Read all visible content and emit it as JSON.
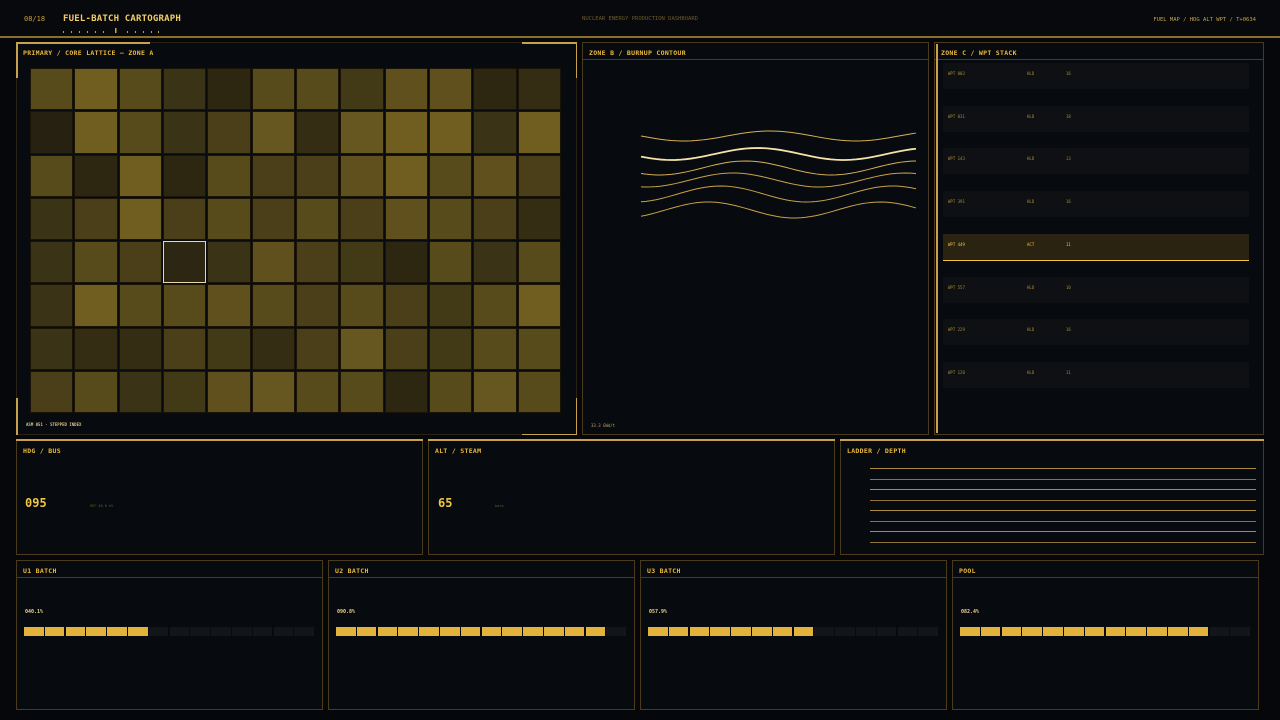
{
  "header": {
    "page_indicator": "08/18",
    "title": "FUEL-BATCH CARTOGRAPH",
    "center_label": "NUCLEAR ENERGY PRODUCTION DASHBOARD",
    "right_label": "FUEL MAP / HDG ALT WPT / T+0634"
  },
  "zone_a": {
    "title": "PRIMARY / CORE LATTICE — ZONE A",
    "footer": "ASM 051 · STEPPED INDEX",
    "rows": 8,
    "cols": 12,
    "selected_cell": 4,
    "levels": [
      [
        0.55,
        0.72,
        0.55,
        0.35,
        0.25,
        0.55,
        0.55,
        0.4,
        0.6,
        0.6,
        0.25,
        0.3
      ],
      [
        0.2,
        0.72,
        0.55,
        0.35,
        0.45,
        0.65,
        0.3,
        0.65,
        0.72,
        0.72,
        0.35,
        0.72
      ],
      [
        0.55,
        0.25,
        0.72,
        0.25,
        0.55,
        0.45,
        0.45,
        0.6,
        0.72,
        0.55,
        0.6,
        0.45
      ],
      [
        0.35,
        0.45,
        0.72,
        0.45,
        0.55,
        0.45,
        0.55,
        0.45,
        0.6,
        0.55,
        0.45,
        0.3
      ],
      [
        0.35,
        0.55,
        0.45,
        0.15,
        0.35,
        0.6,
        0.45,
        0.4,
        0.25,
        0.55,
        0.35,
        0.55
      ],
      [
        0.35,
        0.72,
        0.55,
        0.55,
        0.6,
        0.55,
        0.45,
        0.55,
        0.45,
        0.4,
        0.55,
        0.72
      ],
      [
        0.35,
        0.3,
        0.3,
        0.45,
        0.4,
        0.3,
        0.45,
        0.65,
        0.45,
        0.4,
        0.55,
        0.55
      ],
      [
        0.45,
        0.55,
        0.35,
        0.4,
        0.6,
        0.65,
        0.55,
        0.55,
        0.25,
        0.55,
        0.65,
        0.55
      ]
    ],
    "cell_labels": [
      "",
      "",
      "",
      "",
      "",
      "",
      "",
      "",
      "",
      "",
      "",
      "",
      "",
      "",
      "",
      "",
      "",
      "",
      "",
      "",
      "",
      "",
      "",
      "",
      "",
      "",
      "",
      "",
      "",
      "",
      "",
      "",
      "",
      "",
      "",
      "",
      "",
      "",
      "",
      "",
      "",
      "",
      "",
      "",
      "",
      "",
      "",
      "",
      "",
      "",
      "",
      "",
      "",
      "",
      "",
      "",
      "",
      "",
      "",
      "",
      "",
      "",
      "",
      "",
      "",
      "",
      "",
      "",
      "",
      "",
      "",
      "",
      "",
      "",
      "",
      "",
      "",
      "",
      "",
      "",
      "",
      "",
      "",
      "",
      "",
      "",
      "",
      "",
      "",
      "",
      "",
      "",
      "",
      "",
      "",
      ""
    ]
  },
  "zone_b": {
    "title": "ZONE B / BURNUP CONTOUR",
    "footer": "33.3 GWd/t",
    "curve_count": 6
  },
  "zone_c": {
    "title": "ZONE C / WPT STACK",
    "rows": [
      {
        "name": "WPT 003",
        "mid": "HLD",
        "val": "16"
      },
      {
        "name": "WPT 031",
        "mid": "HLD",
        "val": "18"
      },
      {
        "name": "WPT 143",
        "mid": "HLD",
        "val": "13"
      },
      {
        "name": "WPT 391",
        "mid": "HLD",
        "val": "16"
      },
      {
        "name": "WPT 449",
        "mid": "ACT",
        "val": "11"
      },
      {
        "name": "WPT 557",
        "mid": "HLD",
        "val": "10"
      },
      {
        "name": "WPT 229",
        "mid": "HLD",
        "val": "16"
      },
      {
        "name": "WPT 120",
        "mid": "HLD",
        "val": "11"
      }
    ],
    "active_index": 4
  },
  "hdg": {
    "title": "HDG / BUS",
    "value": "095",
    "sub": "REF 46.0 kV"
  },
  "alt": {
    "title": "ALT / STEAM",
    "value": "65",
    "sub": "bara"
  },
  "ladder": {
    "title": "LADDER / DEPTH",
    "ticks": [
      "",
      "",
      "",
      "",
      "",
      "",
      "",
      ""
    ]
  },
  "batches": [
    {
      "title": "U1 BATCH",
      "readout": "040.1%",
      "filled": 6,
      "total": 14
    },
    {
      "title": "U2 BATCH",
      "readout": "090.8%",
      "filled": 13,
      "total": 14
    },
    {
      "title": "U3 BATCH",
      "readout": "057.9%",
      "filled": 8,
      "total": 14
    },
    {
      "title": "POOL",
      "readout": "082.4%",
      "filled": 12,
      "total": 14
    }
  ],
  "colors": {
    "accent": "#f0c542",
    "cell_base": "#c4a32c",
    "panel_border": "#4a3b1c"
  }
}
